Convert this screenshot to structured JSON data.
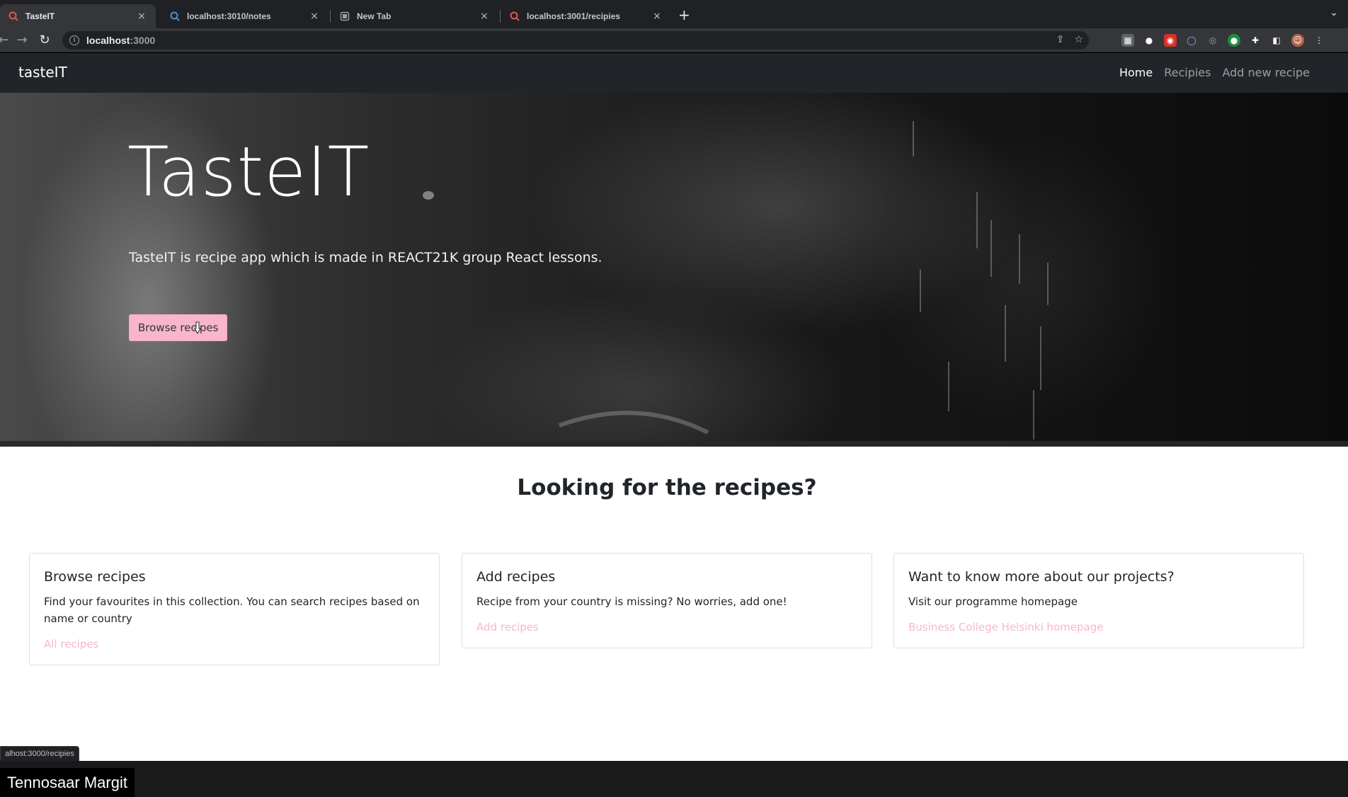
{
  "browser": {
    "tabs": [
      {
        "title": "TasteIT",
        "favicon": "tasteit-favicon",
        "active": true
      },
      {
        "title": "localhost:3010/notes",
        "favicon": "tasteit-favicon",
        "active": false
      },
      {
        "title": "New Tab",
        "favicon": "newtab-favicon",
        "active": false
      },
      {
        "title": "localhost:3001/recipies",
        "favicon": "tasteit-favicon",
        "active": false
      }
    ],
    "close_glyph": "×",
    "new_tab_glyph": "+",
    "menu_glyph": "⌄",
    "address": {
      "host": "localhost",
      "port": ":3000"
    },
    "status_url": "alhost:3000/recipies"
  },
  "app": {
    "brand": "tasteIT",
    "nav": [
      {
        "label": "Home",
        "current": true
      },
      {
        "label": "Recipies",
        "current": false
      },
      {
        "label": "Add new recipe",
        "current": false
      }
    ],
    "hero": {
      "title": "TasteIT",
      "lead": "TasteIT is recipe app which is made in REACT21K group React lessons.",
      "button": "Browse recipes"
    },
    "section_title": "Looking for the recipes?",
    "cards": [
      {
        "title": "Browse recipes",
        "text": "Find your favourites in this collection. You can search recipes based on name or country",
        "link": "All recipes"
      },
      {
        "title": "Add recipes",
        "text": "Recipe from your country is missing? No worries, add one!",
        "link": "Add recipes"
      },
      {
        "title": "Want to know more about our projects?",
        "text": "Visit our programme homepage",
        "link": "Business College Helsinki homepage"
      }
    ]
  },
  "call": {
    "participant_name": "Tennosaar Margit"
  },
  "colors": {
    "accent_pink": "#f7b6cd",
    "navbar": "#212529",
    "chrome_dark": "#202124"
  }
}
